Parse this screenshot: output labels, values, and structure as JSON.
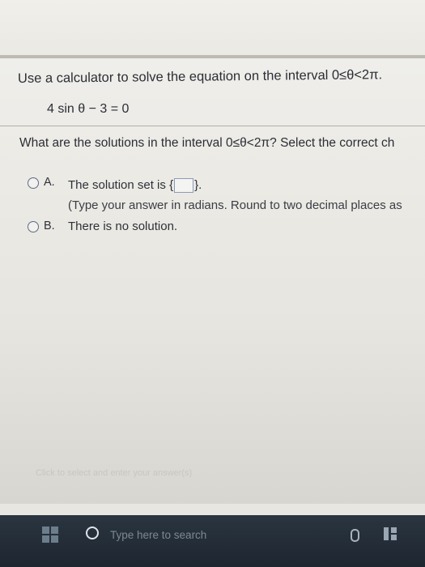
{
  "question": {
    "instruction": "Use a calculator to solve the equation on the interval 0≤θ<2π.",
    "equation": "4 sin θ − 3 = 0",
    "prompt": "What are the solutions in the interval 0≤θ<2π? Select the correct ch"
  },
  "options": [
    {
      "letter": "A.",
      "text_before": "The solution set is",
      "brace_open": "{",
      "brace_close": "}.",
      "hint": "(Type your answer in radians. Round to two decimal places as"
    },
    {
      "letter": "B.",
      "text": "There is no solution."
    }
  ],
  "footer_hint": "Click to select and enter your answer(s)",
  "taskbar": {
    "search_placeholder": "Type here to search"
  },
  "colors": {
    "radio_border": "#5a6b85",
    "taskbar": "#232c36"
  }
}
